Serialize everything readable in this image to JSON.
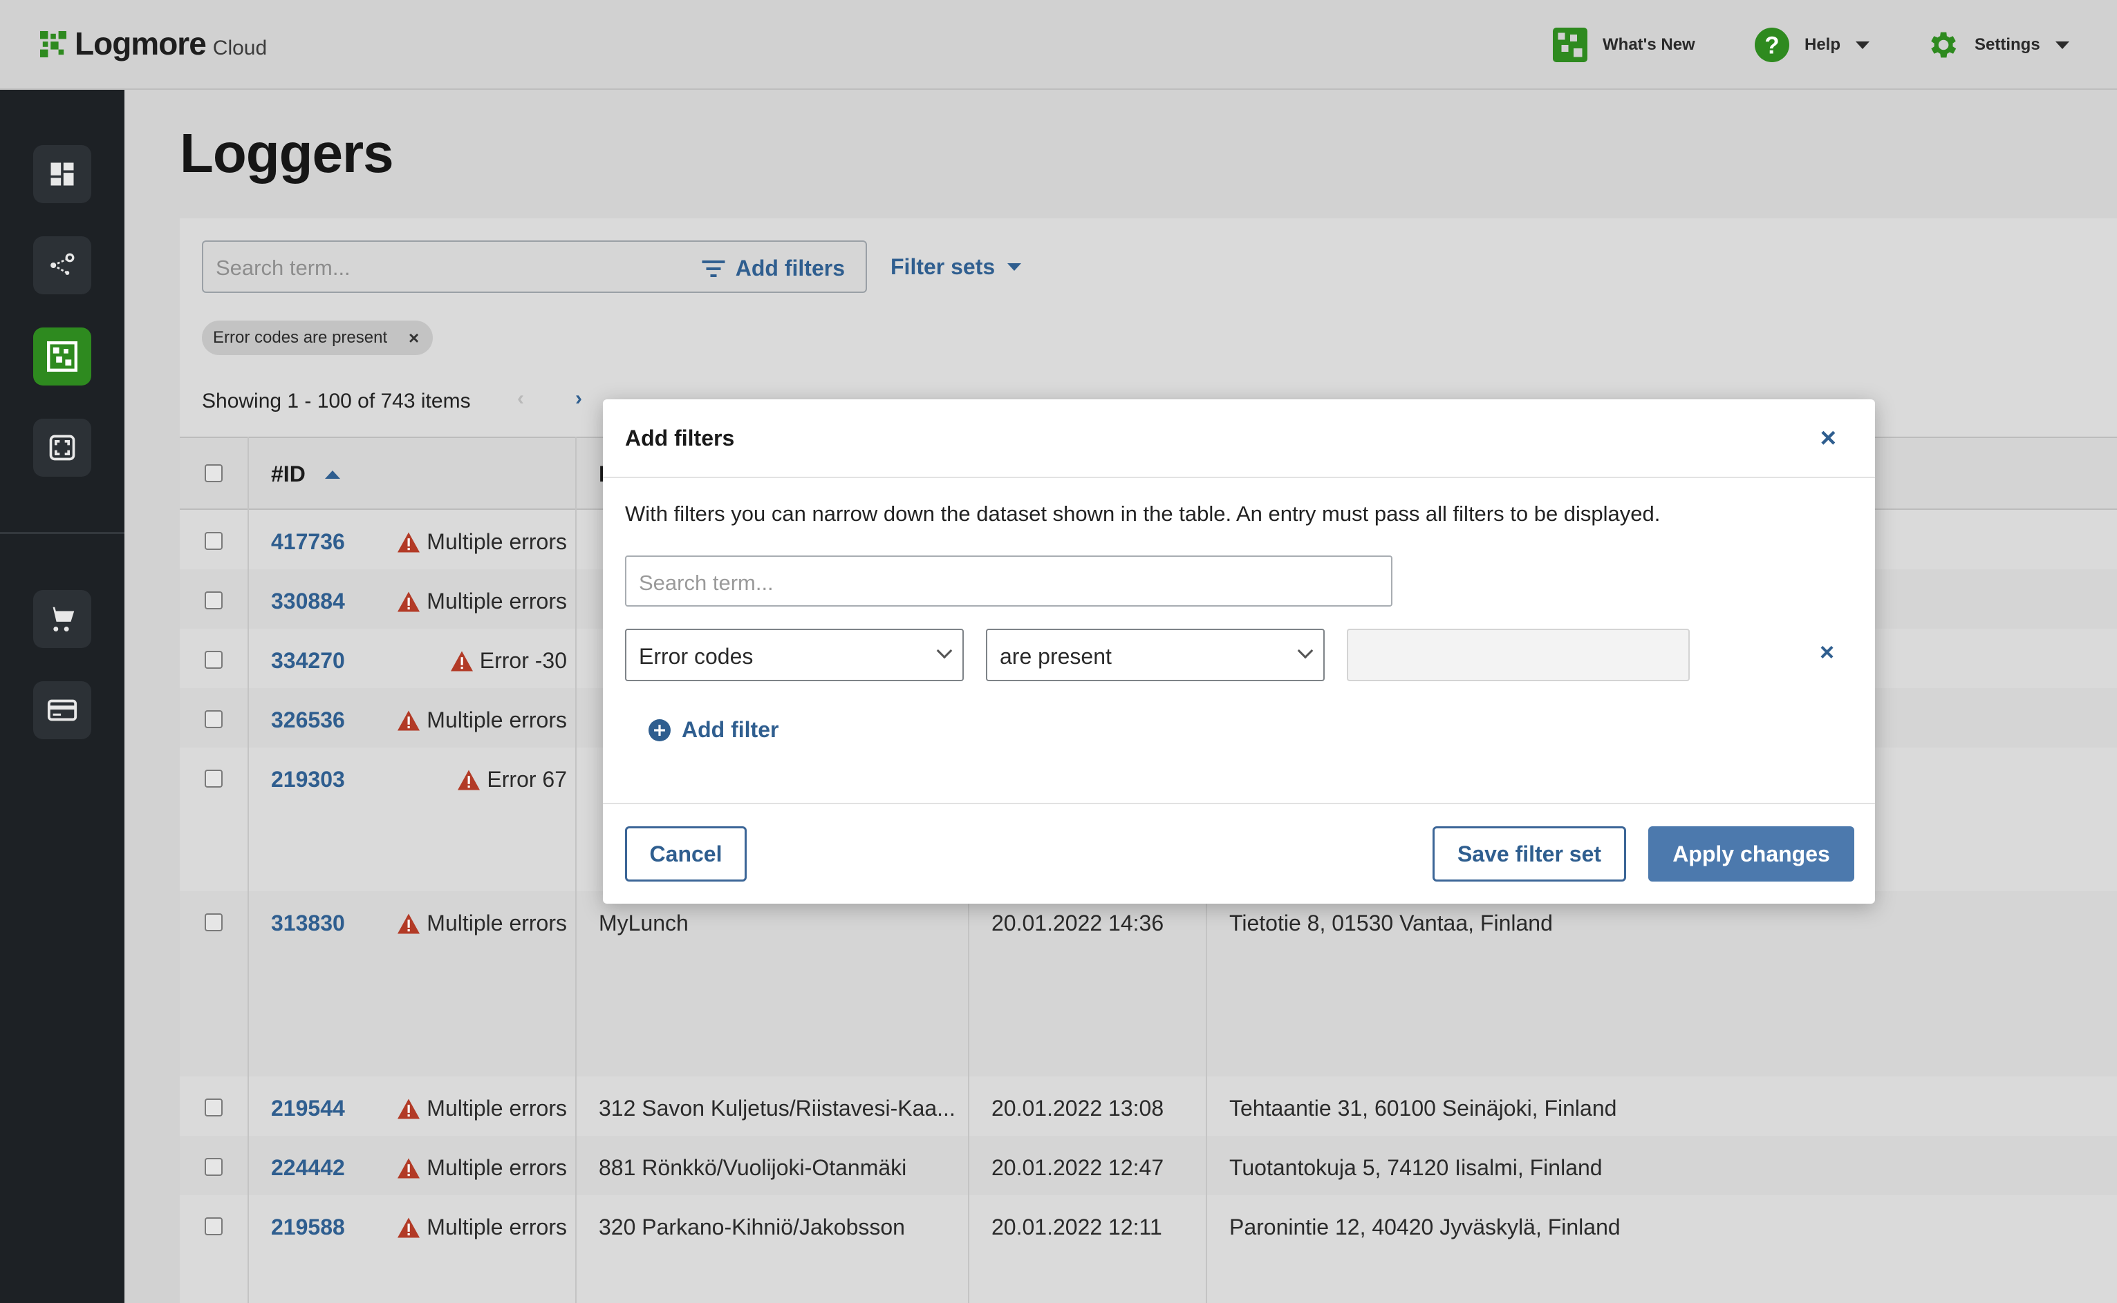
{
  "app": {
    "name": "Logmore",
    "suffix": "Cloud"
  },
  "topnav": {
    "whats_new": "What's New",
    "help": "Help",
    "settings": "Settings"
  },
  "sidebar": {
    "items": [
      "dashboard",
      "network",
      "loggers",
      "scan",
      "shop",
      "billing"
    ],
    "active": "loggers"
  },
  "page": {
    "title": "Loggers"
  },
  "toolbar": {
    "search_placeholder": "Search term...",
    "add_filters": "Add filters",
    "filter_sets": "Filter sets"
  },
  "active_filter": {
    "label": "Error codes are present",
    "remove": "×"
  },
  "pagination": {
    "summary": "Showing 1 - 100 of 743 items",
    "prev": "‹",
    "next": "›"
  },
  "table": {
    "headers": {
      "id": "#ID"
    },
    "rows": [
      {
        "id": "417736",
        "error": "Multiple errors",
        "name": "",
        "date": "",
        "address": ""
      },
      {
        "id": "330884",
        "error": "Multiple errors",
        "name": "",
        "date": "",
        "address": ""
      },
      {
        "id": "334270",
        "error": "Error -30",
        "name": "",
        "date": "",
        "address": ""
      },
      {
        "id": "326536",
        "error": "Multiple errors",
        "name": "",
        "date": "",
        "address": ""
      },
      {
        "id": "219303",
        "error": "Error 67",
        "name": "",
        "date": "",
        "address": ""
      },
      {
        "id": "313830",
        "error": "Multiple errors",
        "name": "MyLunch",
        "date": "20.01.2022 14:36",
        "address": "Tietotie 8, 01530 Vantaa, Finland"
      },
      {
        "id": "219544",
        "error": "Multiple errors",
        "name": "312 Savon Kuljetus/Riistavesi-Kaa...",
        "date": "20.01.2022 13:08",
        "address": "Tehtaantie 31, 60100 Seinäjoki, Finland"
      },
      {
        "id": "224442",
        "error": "Multiple errors",
        "name": "881 Rönkkö/Vuolijoki-Otanmäki",
        "date": "20.01.2022 12:47",
        "address": "Tuotantokuja 5, 74120 Iisalmi, Finland"
      },
      {
        "id": "219588",
        "error": "Multiple errors",
        "name": "320 Parkano-Kihniö/Jakobsson",
        "date": "20.01.2022 12:11",
        "address": "Paronintie 12, 40420 Jyväskylä, Finland"
      }
    ]
  },
  "modal": {
    "title": "Add filters",
    "close": "×",
    "description": "With filters you can narrow down the dataset shown in the table. An entry must pass all filters to be displayed.",
    "search_placeholder": "Search term...",
    "filter_field": "Error codes",
    "filter_operator": "are present",
    "filter_value": "",
    "remove_filter": "×",
    "add_filter": "Add filter",
    "cancel": "Cancel",
    "save_filter_set": "Save filter set",
    "apply": "Apply changes"
  },
  "colors": {
    "brand_green": "#2e8a1f",
    "link_blue": "#2f5e8f",
    "primary_button": "#4c79ad",
    "error_red": "#b23a26",
    "sidebar": "#1d2125"
  }
}
